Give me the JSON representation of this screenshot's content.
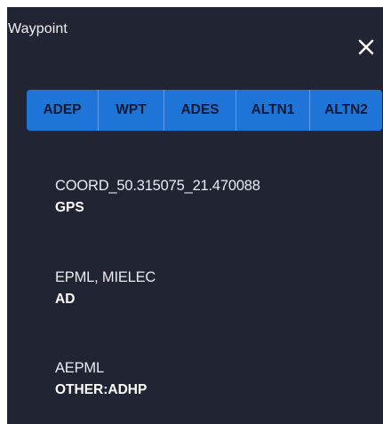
{
  "dialog": {
    "title": "Waypoint",
    "close_icon": "close-icon"
  },
  "tabs": [
    {
      "label": "ADEP"
    },
    {
      "label": "WPT"
    },
    {
      "label": "ADES"
    },
    {
      "label": "ALTN1"
    },
    {
      "label": "ALTN2"
    }
  ],
  "entries": [
    {
      "name": "COORD_50.315075_21.470088",
      "type": "GPS"
    },
    {
      "name": "EPML, MIELEC",
      "type": "AD"
    },
    {
      "name": "AEPML",
      "type": "OTHER:ADHP"
    }
  ],
  "colors": {
    "panel_background": "#202433",
    "tab_bar": "#1f74d8",
    "tab_text": "#0b1a33",
    "text": "#ffffff"
  }
}
